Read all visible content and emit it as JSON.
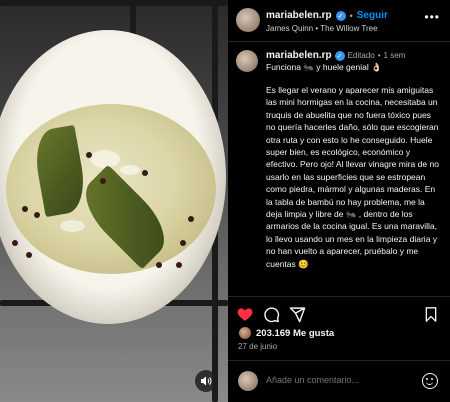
{
  "header": {
    "username": "mariabelen.rp",
    "verified": true,
    "separator": "•",
    "follow_label": "Seguir",
    "song": "James Quinn • The Willow Tree",
    "more_icon": "more-horizontal-icon"
  },
  "caption": {
    "username": "mariabelen.rp",
    "edited_label": "Editado",
    "separator": "•",
    "time_ago": "1 sem",
    "first_line": "Funciona 🐜 y huele genial 👌🏻",
    "body": "Es llegar el verano y aparecer mis amiguitas las mini hormigas en la cocina, necesitaba un truquis de abuelita que no fuera tóxico pues no quería hacerles daño, sólo que escogieran otra ruta y con esto lo he conseguido. Huele super bien, es ecológico, económico y efectivo. Pero ojo! Al llevar vinagre mira de no usarlo en las superficies que se estropean como piedra, mármol y algunas maderas. En la tabla de bambú no hay problema, me la deja limpia y libre de 🐜 , dentro de los armarios de la cocina igual. Es una maravilla, lo llevo usando un mes en la limpieza diaria y no han vuelto a aparecer, pruébalo y me cuentas 😊"
  },
  "actions": {
    "like_icon": "heart-filled-icon",
    "comment_icon": "comment-icon",
    "share_icon": "send-icon",
    "save_icon": "bookmark-icon",
    "like_color": "#ff3040"
  },
  "likes": {
    "count_label": "203.169 Me gusta"
  },
  "date": "27 de junio",
  "comment": {
    "placeholder": "Añade un comentario..."
  },
  "media": {
    "sound_icon": "speaker-icon"
  }
}
